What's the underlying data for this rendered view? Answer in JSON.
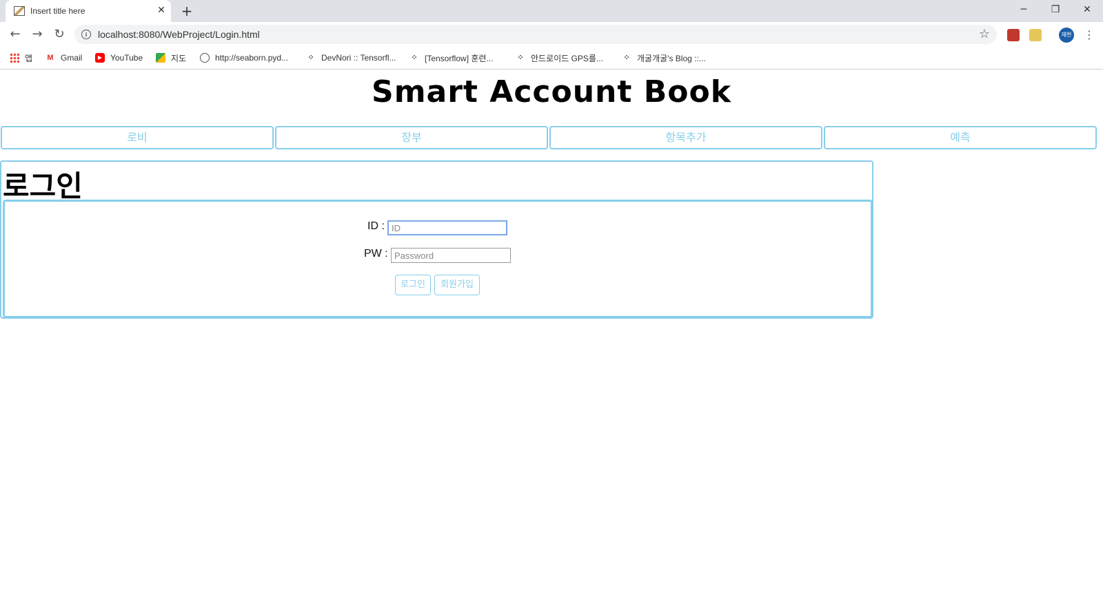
{
  "browser": {
    "tab_title": "Insert title here",
    "url": "localhost:8080/WebProject/Login.html",
    "profile_label": "재현",
    "bookmarks": [
      {
        "label": "앱",
        "icon": "apps-grid-icon"
      },
      {
        "label": "Gmail",
        "icon": "gmail-icon"
      },
      {
        "label": "YouTube",
        "icon": "youtube-icon"
      },
      {
        "label": "지도",
        "icon": "maps-icon"
      },
      {
        "label": "http://seaborn.pyd...",
        "icon": "globe-icon"
      },
      {
        "label": "DevNori :: Tensorfl...",
        "icon": "tistory-icon"
      },
      {
        "label": "[Tensorflow] 훈련...",
        "icon": "tistory-icon"
      },
      {
        "label": "안드로이드 GPS를...",
        "icon": "tistory-icon"
      },
      {
        "label": "개굴개굴's Blog ::...",
        "icon": "tistory-icon"
      }
    ]
  },
  "page": {
    "site_title": "Smart Account Book",
    "menu": [
      "로비",
      "장부",
      "항목추가",
      "예측"
    ],
    "login_heading": "로그인",
    "id_label": "ID :",
    "id_placeholder": "ID",
    "pw_label": "PW :",
    "pw_placeholder": "Password",
    "login_button": "로그인",
    "signup_button": "회원가입"
  },
  "colors": {
    "accent": "#87ceeb",
    "focus": "#7aa7e8"
  }
}
